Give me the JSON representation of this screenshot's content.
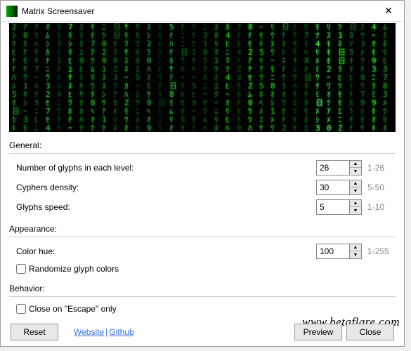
{
  "title": "Matrix Screensaver",
  "sections": {
    "general": {
      "label": "General:",
      "glyphs_label": "Number of glyphs in each level:",
      "glyphs_value": "26",
      "glyphs_hint": "1-26",
      "density_label": "Cyphers density:",
      "density_value": "30",
      "density_hint": "5-50",
      "speed_label": "Glyphs speed:",
      "speed_value": "5",
      "speed_hint": "1-10"
    },
    "appearance": {
      "label": "Appearance:",
      "hue_label": "Color hue:",
      "hue_value": "100",
      "hue_hint": "1-255",
      "randomize_label": "Randomize glyph colors",
      "randomize_checked": false
    },
    "behavior": {
      "label": "Behavior:",
      "escape_label": "Close on \"Escape\" only",
      "escape_checked": false
    }
  },
  "buttons": {
    "reset": "Reset",
    "preview": "Preview",
    "close": "Close"
  },
  "links": {
    "website": "Website",
    "github": "Github"
  },
  "watermark": "www.betaflare.com"
}
